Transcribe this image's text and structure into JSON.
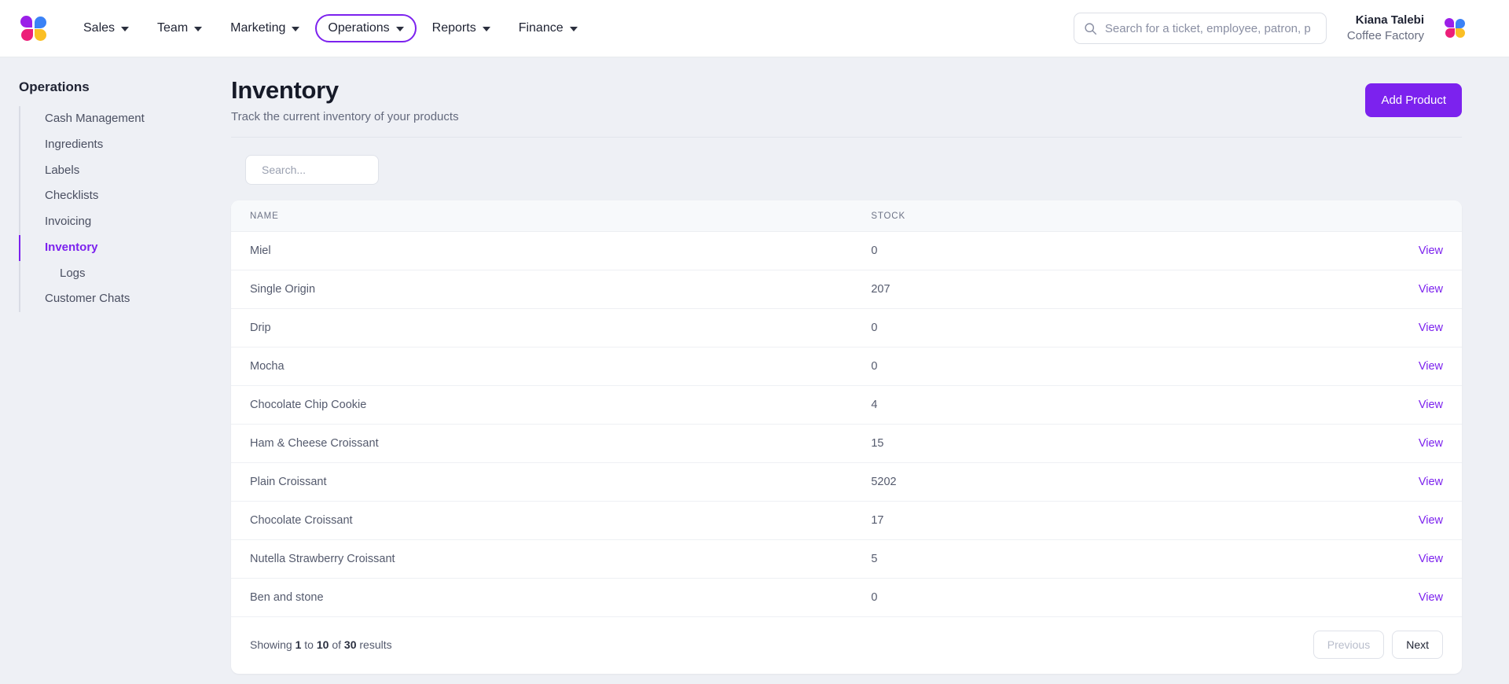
{
  "brand": {
    "logo_icon": "pinwheel-logo-icon",
    "colors": {
      "accent": "#7c22ee",
      "petal_purple": "#9b1fe8",
      "petal_blue": "#3b82f6",
      "petal_pink": "#ec1e79",
      "petal_yellow": "#fbbf24",
      "page_bg": "#eef0f5",
      "table_header_bg": "#f7f9fb"
    }
  },
  "topnav": {
    "items": [
      {
        "label": "Sales",
        "active": false
      },
      {
        "label": "Team",
        "active": false
      },
      {
        "label": "Marketing",
        "active": false
      },
      {
        "label": "Operations",
        "active": true
      },
      {
        "label": "Reports",
        "active": false
      },
      {
        "label": "Finance",
        "active": false
      }
    ],
    "search": {
      "icon": "search-icon",
      "value": "",
      "placeholder": "Search for a ticket, employee, patron, p"
    },
    "profile": {
      "name": "Kiana Talebi",
      "org": "Coffee Factory",
      "avatar_icon": "pinwheel-avatar-icon"
    }
  },
  "sidebar": {
    "title": "Operations",
    "items": [
      {
        "label": "Cash Management",
        "current": false,
        "sub": false
      },
      {
        "label": "Ingredients",
        "current": false,
        "sub": false
      },
      {
        "label": "Labels",
        "current": false,
        "sub": false
      },
      {
        "label": "Checklists",
        "current": false,
        "sub": false
      },
      {
        "label": "Invoicing",
        "current": false,
        "sub": false
      },
      {
        "label": "Inventory",
        "current": true,
        "sub": false
      },
      {
        "label": "Logs",
        "current": false,
        "sub": true
      },
      {
        "label": "Customer Chats",
        "current": false,
        "sub": false
      }
    ]
  },
  "page": {
    "title": "Inventory",
    "subtitle": "Track the current inventory of your products",
    "add_button": "Add Product"
  },
  "toolbar": {
    "search": {
      "icon": "search-icon",
      "value": "",
      "placeholder": "Search..."
    }
  },
  "table": {
    "columns": [
      "NAME",
      "STOCK",
      ""
    ],
    "action_label": "View",
    "rows": [
      {
        "name": "Miel",
        "stock": "0"
      },
      {
        "name": "Single Origin",
        "stock": "207"
      },
      {
        "name": "Drip",
        "stock": "0"
      },
      {
        "name": "Mocha",
        "stock": "0"
      },
      {
        "name": "Chocolate Chip Cookie",
        "stock": "4"
      },
      {
        "name": "Ham & Cheese Croissant",
        "stock": "15"
      },
      {
        "name": "Plain Croissant",
        "stock": "5202"
      },
      {
        "name": "Chocolate Croissant",
        "stock": "17"
      },
      {
        "name": "Nutella Strawberry Croissant",
        "stock": "5"
      },
      {
        "name": "Ben and stone",
        "stock": "0"
      }
    ]
  },
  "pagination": {
    "summary_prefix": "Showing ",
    "from": "1",
    "summary_mid": " to ",
    "to": "10",
    "summary_mid2": " of ",
    "total": "30",
    "summary_suffix": " results",
    "previous_label": "Previous",
    "next_label": "Next",
    "previous_disabled": true
  }
}
